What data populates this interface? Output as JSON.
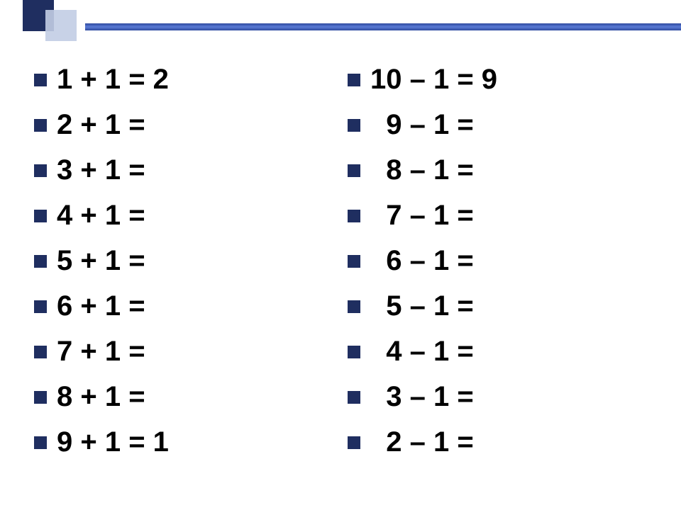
{
  "columns": {
    "left": [
      {
        "text": "1 + 1 = 2",
        "indent": false
      },
      {
        "text": "2 + 1 =",
        "indent": false
      },
      {
        "text": "3 + 1 =",
        "indent": false
      },
      {
        "text": "4 + 1 =",
        "indent": false
      },
      {
        "text": "5 + 1 =",
        "indent": false
      },
      {
        "text": "6 + 1 =",
        "indent": false
      },
      {
        "text": "7 + 1 =",
        "indent": false
      },
      {
        "text": "8 + 1 =",
        "indent": false
      },
      {
        "text": "9 + 1 = 1",
        "indent": false
      }
    ],
    "right": [
      {
        "text": "10 – 1 = 9",
        "indent": false
      },
      {
        "text": "9 – 1 =",
        "indent": true
      },
      {
        "text": "8 – 1 =",
        "indent": true
      },
      {
        "text": "7 – 1 =",
        "indent": true
      },
      {
        "text": "6 – 1 =",
        "indent": true
      },
      {
        "text": "5 – 1 =",
        "indent": true
      },
      {
        "text": "4 – 1 =",
        "indent": true
      },
      {
        "text": "3 – 1 =",
        "indent": true
      },
      {
        "text": "2 – 1 =",
        "indent": true
      }
    ]
  },
  "colors": {
    "bullet": "#1f2e60",
    "text": "#000000",
    "header_bar": "#2f4a9e",
    "header_square_dark": "#1f2e60",
    "header_square_light": "#c2cde4"
  }
}
